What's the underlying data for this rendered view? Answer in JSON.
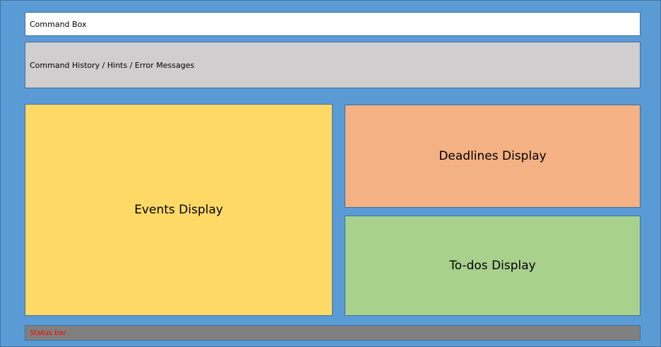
{
  "command_box": {
    "label": "Command Box"
  },
  "history": {
    "label": "Command History / Hints / Error Messages"
  },
  "events": {
    "label": "Events Display"
  },
  "deadlines": {
    "label": "Deadlines Display"
  },
  "todos": {
    "label": "To-dos Display"
  },
  "status_bar": {
    "label": "Status bar"
  },
  "colors": {
    "background": "#5b9bd5",
    "command_box": "#ffffff",
    "history": "#d0cece",
    "events": "#ffd966",
    "deadlines": "#f4b183",
    "todos": "#a9d18e",
    "status_bar": "#808080",
    "status_text": "#ff0000"
  }
}
